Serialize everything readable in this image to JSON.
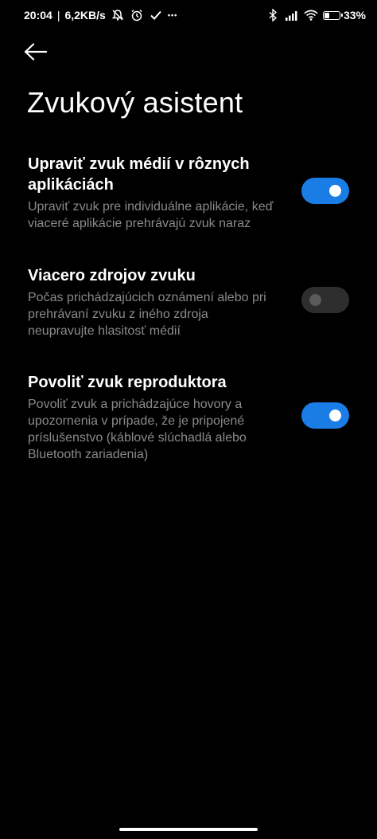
{
  "status_bar": {
    "time": "20:04",
    "separator": "|",
    "network_speed": "6,2KB/s",
    "more_indicator": "•••",
    "battery_percent": "33",
    "battery_level": 0.33,
    "icons_left": [
      "do-not-disturb-icon",
      "alarm-icon",
      "check-icon"
    ],
    "icons_right": [
      "bluetooth-icon",
      "signal-icon",
      "wifi-icon",
      "battery-icon"
    ]
  },
  "header": {
    "back_icon": "arrow-left-icon",
    "title": "Zvukový asistent"
  },
  "settings": [
    {
      "title": "Upraviť zvuk médií v rôznych aplikáciách",
      "description": "Upraviť zvuk pre individuálne aplikácie, keď viaceré aplikácie prehrávajú zvuk naraz",
      "enabled": true
    },
    {
      "title": "Viacero zdrojov zvuku",
      "description": "Počas prichádzajúcich oznámení alebo pri prehrávaní zvuku z iného zdroja neupravujte hlasitosť médií",
      "enabled": false
    },
    {
      "title": "Povoliť zvuk reproduktora",
      "description": "Povoliť zvuk a prichádzajúce hovory a upozornenia v prípade, že je pripojené príslušenstvo (káblové slúchadlá alebo Bluetooth zariadenia)",
      "enabled": true
    }
  ],
  "colors": {
    "background": "#000000",
    "accent": "#1a7de6",
    "secondary_text": "#8a8a8a",
    "toggle_off": "#2e2e2e"
  }
}
